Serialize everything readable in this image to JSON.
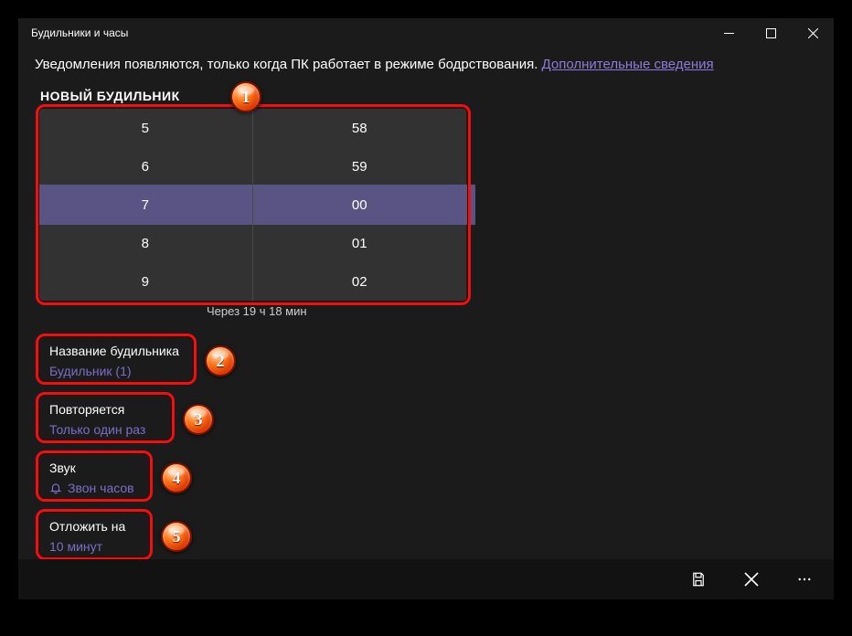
{
  "window": {
    "title": "Будильники и часы"
  },
  "notice": {
    "text": "Уведомления появляются, только когда ПК работает в режиме бодрствования. ",
    "link": "Дополнительные сведения"
  },
  "section_title": "НОВЫЙ БУДИЛЬНИК",
  "time_picker": {
    "hours": [
      "5",
      "6",
      "7",
      "8",
      "9"
    ],
    "minutes": [
      "58",
      "59",
      "00",
      "01",
      "02"
    ],
    "selected_hour": "7",
    "selected_minute": "00",
    "hint": "Через 19 ч 18 мин"
  },
  "options": {
    "name": {
      "label": "Название будильника",
      "value": "Будильник (1)"
    },
    "repeat": {
      "label": "Повторяется",
      "value": "Только один раз"
    },
    "sound": {
      "label": "Звук",
      "value": "Звон часов"
    },
    "snooze": {
      "label": "Отложить на",
      "value": "10 минут"
    }
  },
  "callouts": {
    "c1": "1",
    "c2": "2",
    "c3": "3",
    "c4": "4",
    "c5": "5"
  },
  "bottombar": {
    "save": "save",
    "cancel": "cancel",
    "more": "more"
  }
}
